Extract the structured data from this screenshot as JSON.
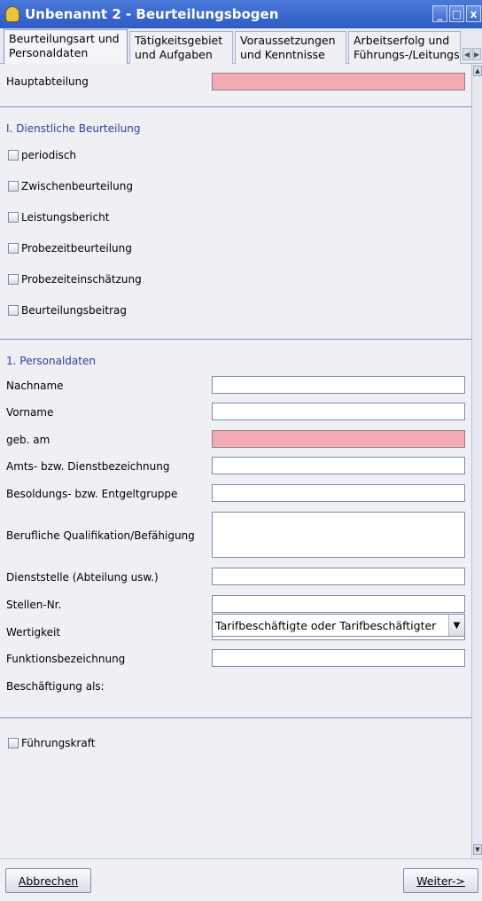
{
  "window": {
    "title": "Unbenannt 2 - Beurteilungsbogen",
    "minimize_glyph": "_",
    "maximize_glyph": "□",
    "close_glyph": "x"
  },
  "tabs": [
    {
      "line1": "Beurteilungsart und",
      "line2": "Personaldaten"
    },
    {
      "line1": "Tätigkeitsgebiet",
      "line2": "und Aufgaben"
    },
    {
      "line1": "Voraussetzungen",
      "line2": "und Kenntnisse"
    },
    {
      "line1": "Arbeitserfolg und",
      "line2": "Führungs-/Leitungs"
    }
  ],
  "form": {
    "hauptabteilung": "Hauptabteilung",
    "section1_title": "I. Dienstliche Beurteilung",
    "checkboxes": [
      "periodisch",
      "Zwischenbeurteilung",
      "Leistungsbericht",
      "Probezeitbeurteilung",
      "Probezeiteinschätzung",
      "Beurteilungsbeitrag"
    ],
    "section2_title": "1. Personaldaten",
    "fields": [
      "Nachname",
      "Vorname",
      "geb. am",
      "Amts- bzw. Dienstbezeichnung",
      "Besoldungs- bzw. Entgeltgruppe",
      "Berufliche Qualifikation/Befähigung",
      "Dienststelle (Abteilung usw.)",
      "Stellen-Nr.",
      "Wertigkeit",
      "Funktionsbezeichnung",
      "Beschäftigung als:"
    ],
    "beschaeftigung_value": "Tarifbeschäftigte oder Tarifbeschäftigter",
    "fuehrungskraft": "Führungskraft"
  },
  "buttons": {
    "cancel": "Abbrechen",
    "next": "Weiter->"
  },
  "colors": {
    "titlebar": "#2f5bc4",
    "required_field": "#f2aab4",
    "section_text": "#2f3f9c"
  }
}
